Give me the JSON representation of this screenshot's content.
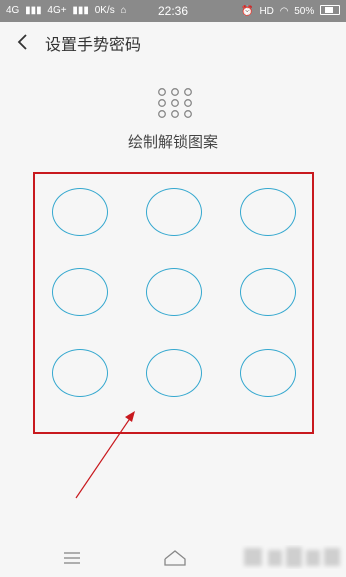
{
  "status_bar": {
    "network1": "4G",
    "network2": "4G+",
    "speed": "0K/s",
    "time": "22:36",
    "hd": "HD",
    "battery": "50%",
    "battery_level": 0.5
  },
  "header": {
    "title": "设置手势密码"
  },
  "main": {
    "instruction": "绘制解锁图案",
    "pattern": {
      "dot_count": 9,
      "columns": 3
    }
  },
  "colors": {
    "highlight_box": "#c8191e",
    "dot_outline": "#35a8cf",
    "arrow": "#c8191e"
  },
  "icons": {
    "back": "chevron-left-icon",
    "pattern": "grid-dots-icon",
    "menu": "menu-icon",
    "home": "home-icon"
  }
}
